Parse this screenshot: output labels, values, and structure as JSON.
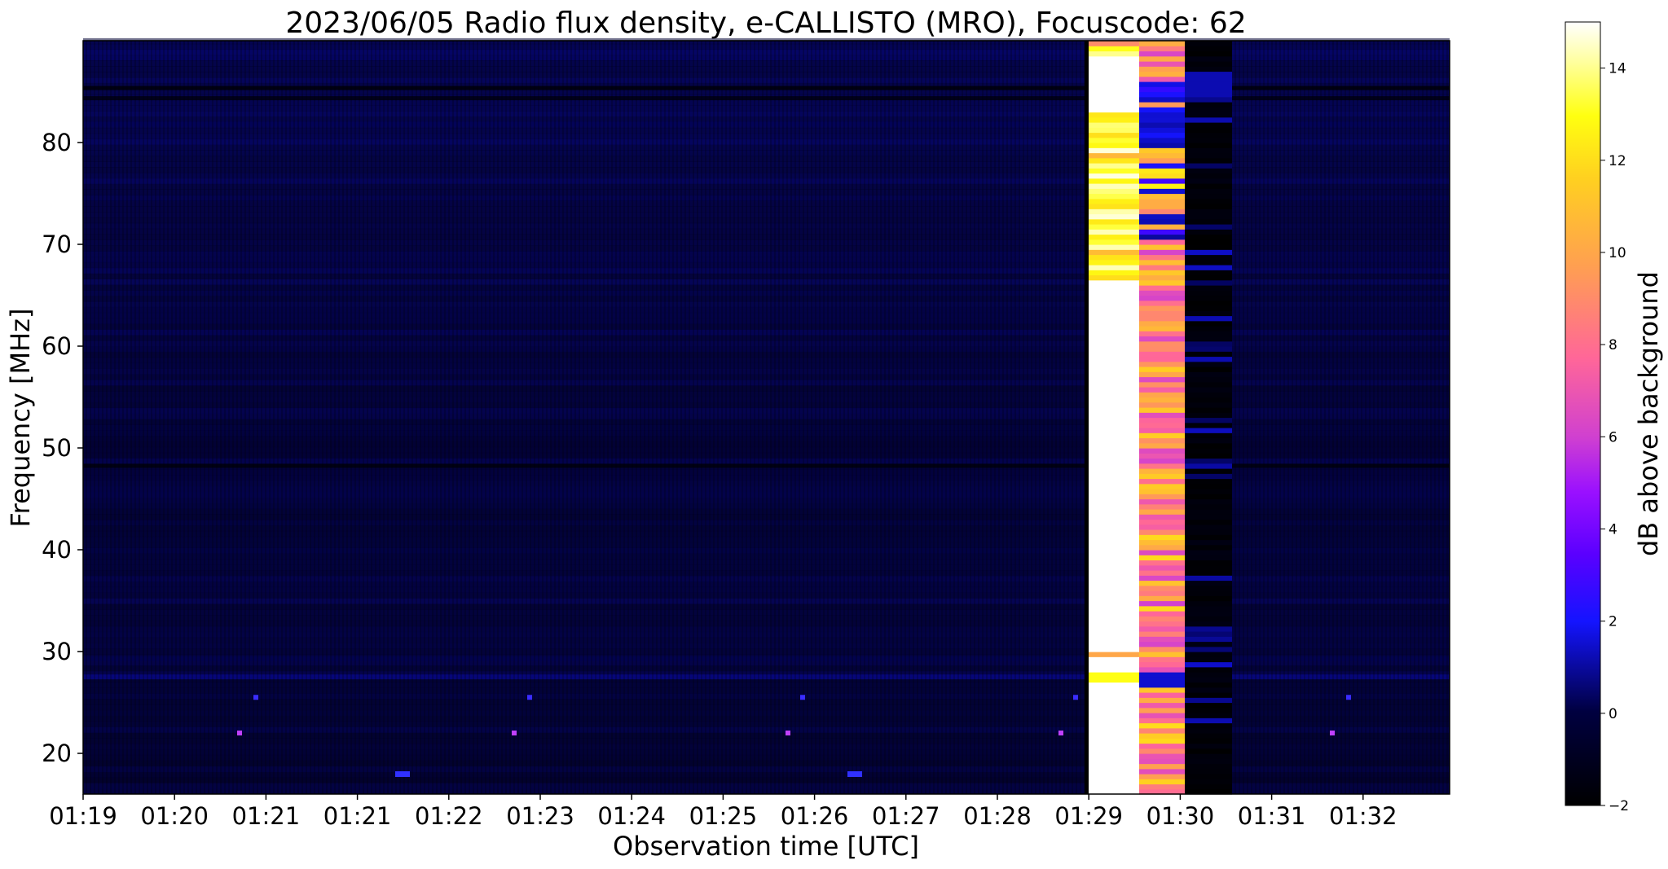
{
  "chart_data": {
    "type": "heatmap",
    "title": "2023/06/05  Radio flux density, e-CALLISTO (MRO), Focuscode: 62",
    "xlabel": "Observation time [UTC]",
    "ylabel": "Frequency [MHz]",
    "x_tick_labels": [
      "01:19",
      "01:20",
      "01:21",
      "01:21",
      "01:22",
      "01:23",
      "01:24",
      "01:25",
      "01:26",
      "01:27",
      "01:28",
      "01:29",
      "01:30",
      "01:31",
      "01:32"
    ],
    "y_ticks": [
      20,
      30,
      40,
      50,
      60,
      70,
      80
    ],
    "ylim": [
      16,
      90
    ],
    "colorbar": {
      "label": "dB above background",
      "range": [
        -2,
        15
      ],
      "ticks": [
        -2,
        0,
        2,
        4,
        6,
        8,
        10,
        12,
        14
      ],
      "tick_labels": [
        "−2",
        "0",
        "2",
        "4",
        "6",
        "8",
        "10",
        "12",
        "14"
      ],
      "colormap": "gnuplot2"
    },
    "background_level_db": 0,
    "events": [
      {
        "approx_time": "01:29",
        "approx_db": 15,
        "description_level": "saturated"
      },
      {
        "approx_time": "01:30",
        "approx_db": 9
      },
      {
        "approx_time": "01:30",
        "approx_db": -1.5
      }
    ]
  }
}
